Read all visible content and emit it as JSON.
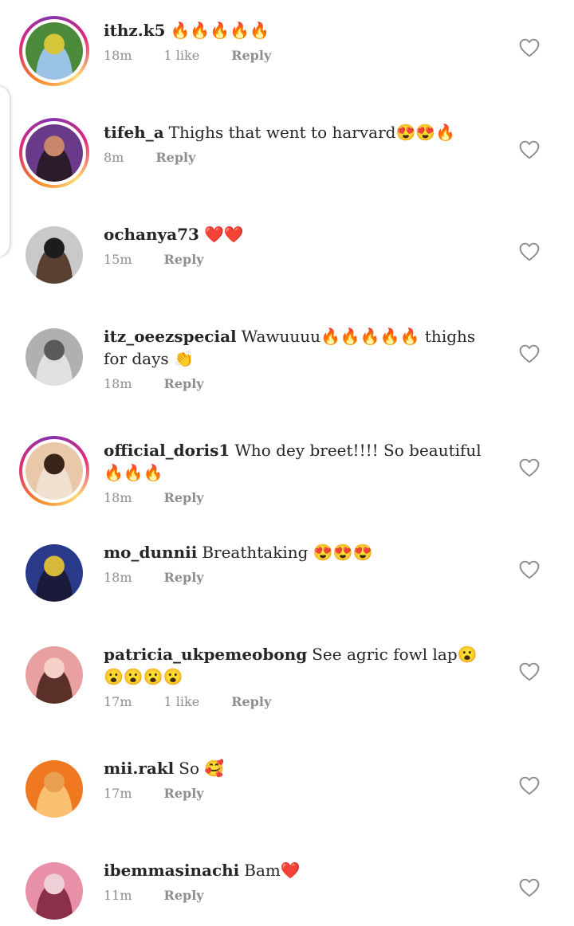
{
  "comments": [
    {
      "username": "ithz.k5",
      "text": "🔥🔥🔥🔥🔥",
      "time": "18m",
      "likes": "1 like",
      "reply": "Reply",
      "ring": true,
      "avatar_colors": [
        "#4a8a3a",
        "#d6c63a",
        "#9bc3e6"
      ]
    },
    {
      "username": "tifeh_a",
      "text": "Thighs that went to harvard😍😍🔥",
      "time": "8m",
      "likes": "",
      "reply": "Reply",
      "ring": true,
      "avatar_colors": [
        "#6a3a8a",
        "#c8866a",
        "#2b1a2a"
      ]
    },
    {
      "username": "ochanya73",
      "text": "❤️❤️",
      "time": "15m",
      "likes": "",
      "reply": "Reply",
      "ring": false,
      "avatar_colors": [
        "#c9c9c9",
        "#1c1c1c",
        "#5a4030"
      ]
    },
    {
      "username": "itz_oeezspecial",
      "text": "Wawuuuu🔥🔥🔥🔥🔥 thighs for days 👏",
      "time": "18m",
      "likes": "",
      "reply": "Reply",
      "ring": false,
      "avatar_colors": [
        "#b0b0b0",
        "#5a5a5a",
        "#e0e0e0"
      ]
    },
    {
      "username": "official_doris1",
      "text": "Who dey breet!!!! So beautiful 🔥🔥🔥",
      "time": "18m",
      "likes": "",
      "reply": "Reply",
      "ring": true,
      "avatar_colors": [
        "#e8c8a8",
        "#3a2418",
        "#f0e0d0"
      ]
    },
    {
      "username": "mo_dunnii",
      "text": "Breathtaking 😍😍😍",
      "time": "18m",
      "likes": "",
      "reply": "Reply",
      "ring": false,
      "avatar_colors": [
        "#2a3a8a",
        "#d8b83a",
        "#1a1a3a"
      ]
    },
    {
      "username": "patricia_ukpemeobong",
      "text": "See agric fowl lap😮😮😮😮😮",
      "time": "17m",
      "likes": "1 like",
      "reply": "Reply",
      "ring": false,
      "avatar_colors": [
        "#e8a0a0",
        "#f4d0c8",
        "#5a3028"
      ]
    },
    {
      "username": "mii.rakl",
      "text": "So 🥰",
      "time": "17m",
      "likes": "",
      "reply": "Reply",
      "ring": false,
      "avatar_colors": [
        "#f07820",
        "#e8a050",
        "#f8c070"
      ]
    },
    {
      "username": "ibemmasinachi",
      "text": "Bam❤️",
      "time": "11m",
      "likes": "",
      "reply": "Reply",
      "ring": false,
      "avatar_colors": [
        "#e890a8",
        "#f0d0d8",
        "#8a3048"
      ]
    }
  ],
  "icons": {
    "like": "heart-outline-icon"
  }
}
